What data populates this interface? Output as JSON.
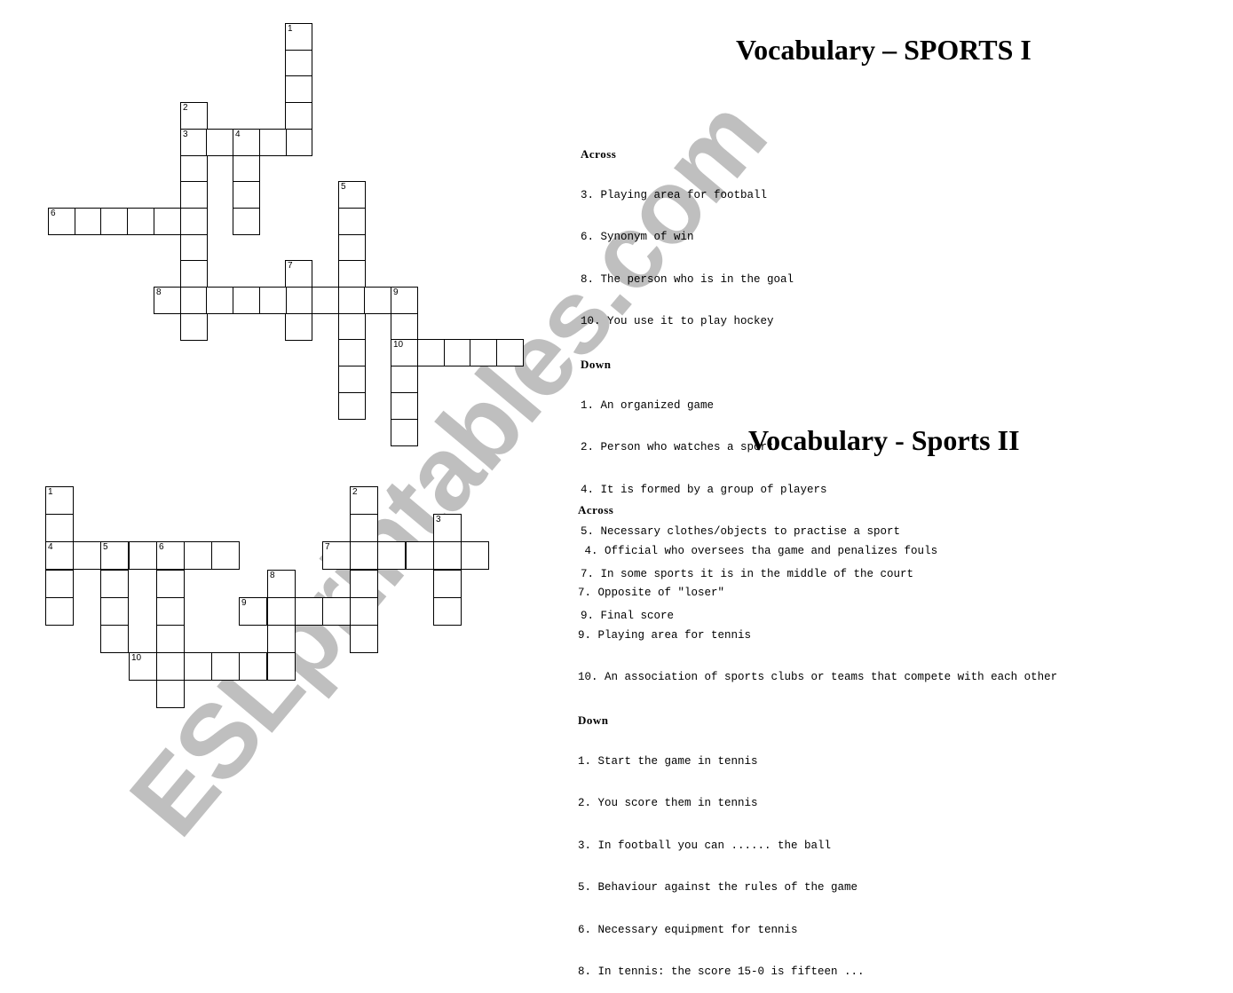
{
  "watermark": "ESLprintables.com",
  "puzzles": [
    {
      "title": "Vocabulary – SPORTS I",
      "across_label": "Across",
      "down_label": "Down",
      "across": [
        "3. Playing area for football",
        "6. Synonym of win",
        "8. The person who is in the goal",
        "10. You use it to play hockey"
      ],
      "down": [
        "1. An organized game",
        "2. Person who watches a sport",
        "4. It is formed by a group of players",
        "5. Necessary clothes/objects to practise a sport",
        "7. In some sports it is in the middle of the court",
        "9. Final score"
      ],
      "entries": [
        {
          "num": "1",
          "dir": "down",
          "row": 0,
          "col": 9,
          "len": 5
        },
        {
          "num": "2",
          "dir": "down",
          "row": 3,
          "col": 5,
          "len": 9
        },
        {
          "num": "3",
          "dir": "across",
          "row": 4,
          "col": 5,
          "len": 5
        },
        {
          "num": "4",
          "dir": "down",
          "row": 4,
          "col": 7,
          "len": 4
        },
        {
          "num": "5",
          "dir": "down",
          "row": 6,
          "col": 11,
          "len": 9
        },
        {
          "num": "6",
          "dir": "across",
          "row": 7,
          "col": 0,
          "len": 6
        },
        {
          "num": "7",
          "dir": "down",
          "row": 9,
          "col": 9,
          "len": 3
        },
        {
          "num": "8",
          "dir": "across",
          "row": 10,
          "col": 4,
          "len": 10
        },
        {
          "num": "9",
          "dir": "down",
          "row": 10,
          "col": 13,
          "len": 6
        },
        {
          "num": "10",
          "dir": "across",
          "row": 12,
          "col": 13,
          "len": 5
        }
      ]
    },
    {
      "title": "Vocabulary - Sports II",
      "across_label": "Across",
      "down_label": "Down",
      "across": [
        " 4. Official who oversees tha game and penalizes fouls",
        "7. Opposite of \"loser\"",
        "9. Playing area for tennis",
        "10. An association of sports clubs or teams that compete with each other"
      ],
      "down": [
        "1. Start the game in tennis",
        "2. You score them in tennis",
        "3. In football you can ...... the ball",
        "5. Behaviour against the rules of the game",
        "6. Necessary equipment for tennis",
        "8. In tennis: the score 15-0 is fifteen ..."
      ],
      "entries": [
        {
          "num": "1",
          "dir": "down",
          "row": 0,
          "col": 0,
          "len": 5
        },
        {
          "num": "2",
          "dir": "down",
          "row": 0,
          "col": 11,
          "len": 6
        },
        {
          "num": "3",
          "dir": "down",
          "row": 1,
          "col": 14,
          "len": 4
        },
        {
          "num": "4",
          "dir": "across",
          "row": 2,
          "col": 0,
          "len": 7
        },
        {
          "num": "5",
          "dir": "down",
          "row": 2,
          "col": 2,
          "len": 4
        },
        {
          "num": "6",
          "dir": "down",
          "row": 2,
          "col": 4,
          "len": 6
        },
        {
          "num": "7",
          "dir": "across",
          "row": 2,
          "col": 10,
          "len": 6
        },
        {
          "num": "8",
          "dir": "down",
          "row": 3,
          "col": 8,
          "len": 4
        },
        {
          "num": "9",
          "dir": "across",
          "row": 4,
          "col": 7,
          "len": 5
        },
        {
          "num": "10",
          "dir": "across",
          "row": 6,
          "col": 3,
          "len": 6
        }
      ]
    }
  ]
}
